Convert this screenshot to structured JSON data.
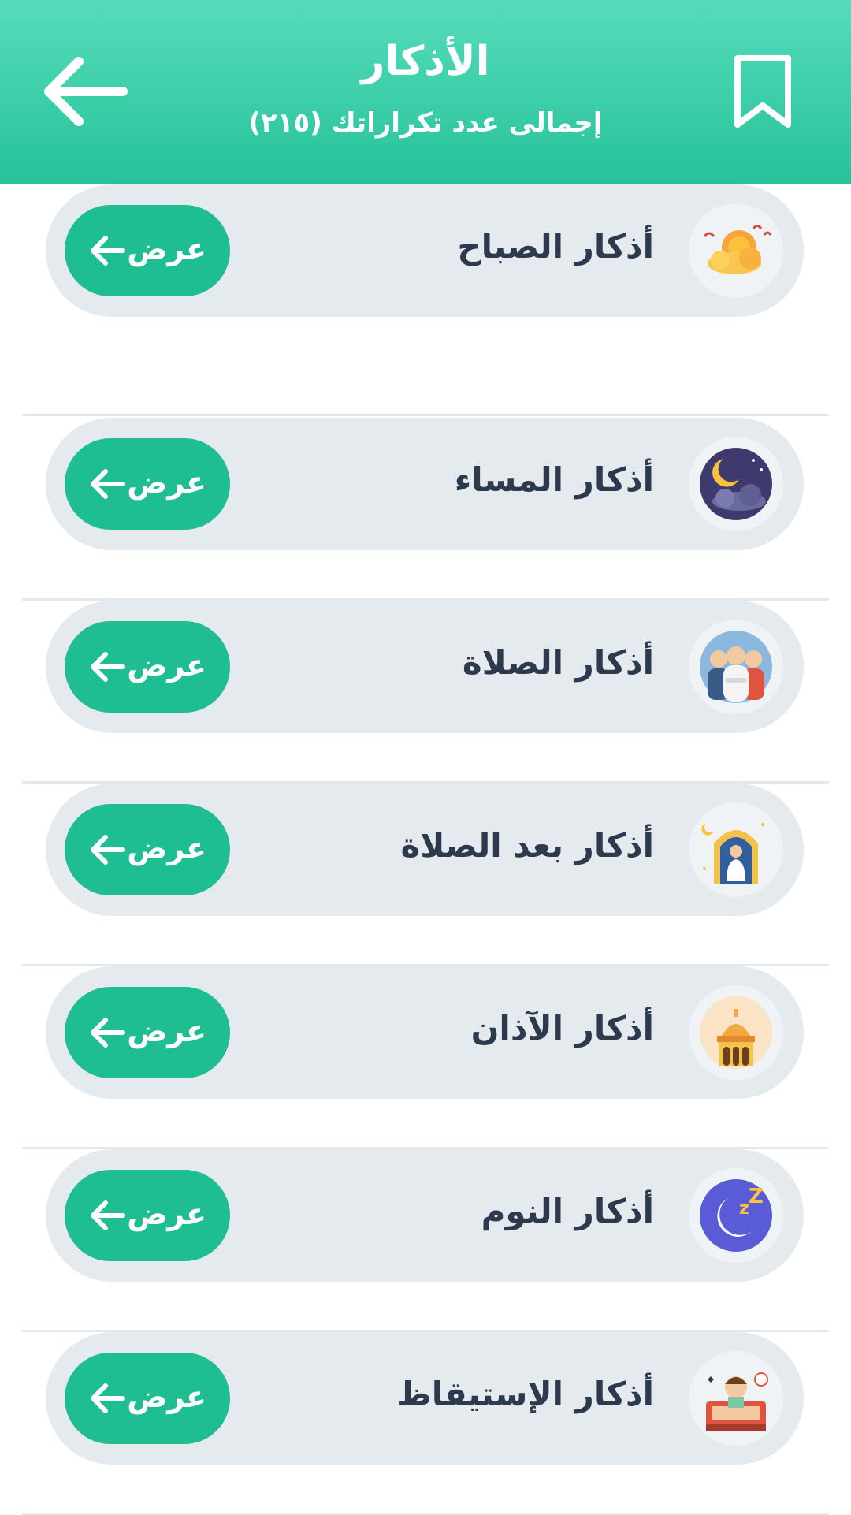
{
  "header": {
    "title": "الأذكار",
    "subtitle": "إجمالى عدد تكراراتك (٢١٥)",
    "back_icon": "arrow-left-icon",
    "bookmark_icon": "bookmark-icon"
  },
  "colors": {
    "header_gradient_top": "#56dcbb",
    "header_gradient_bottom": "#27c29a",
    "button": "#1fbd92",
    "card": "#e4eaee",
    "text": "#2d3a4d"
  },
  "items": [
    {
      "label": "أذكار الصباح",
      "button_label": "عرض",
      "icon": "morning-sun-cloud-icon"
    },
    {
      "label": "أذكار المساء",
      "button_label": "عرض",
      "icon": "evening-moon-cloud-icon"
    },
    {
      "label": "أذكار الصلاة",
      "button_label": "عرض",
      "icon": "prayer-people-icon"
    },
    {
      "label": "أذكار بعد الصلاة",
      "button_label": "عرض",
      "icon": "praying-man-mosque-icon"
    },
    {
      "label": "أذكار الآذان",
      "button_label": "عرض",
      "icon": "mosque-dome-icon"
    },
    {
      "label": "أذكار النوم",
      "button_label": "عرض",
      "icon": "sleep-moon-icon"
    },
    {
      "label": "أذكار الإستيقاظ",
      "button_label": "عرض",
      "icon": "wake-up-bed-icon"
    }
  ]
}
